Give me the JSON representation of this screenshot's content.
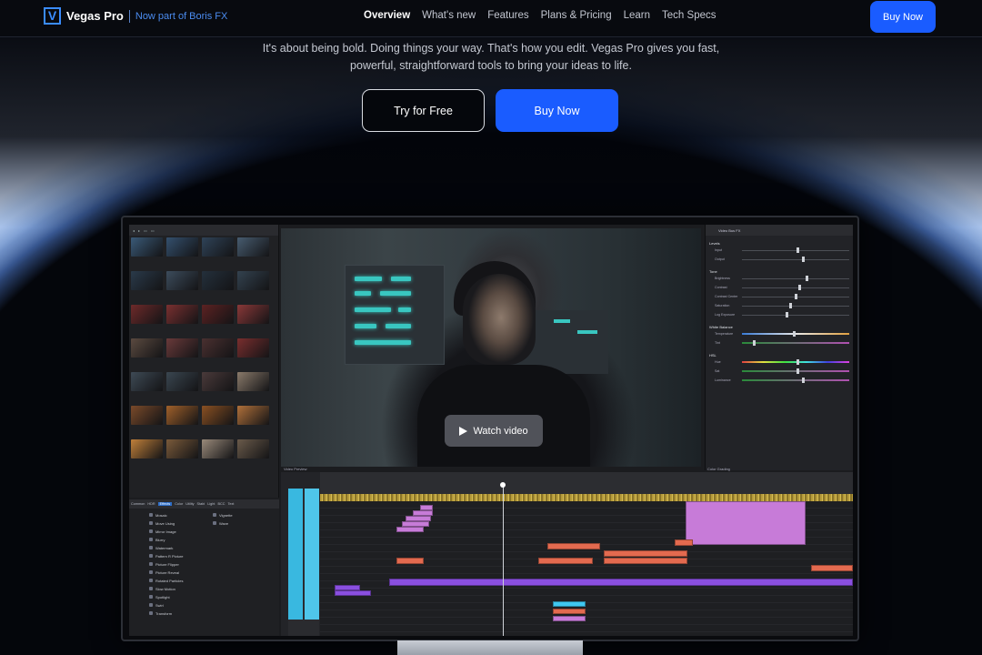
{
  "nav": {
    "logo_mark": "V",
    "logo_name": "Vegas Pro",
    "logo_tag": "Now part of Boris FX",
    "links": [
      "Overview",
      "What's new",
      "Features",
      "Plans & Pricing",
      "Learn",
      "Tech Specs"
    ],
    "active_link": "Overview",
    "buy_label": "Buy Now"
  },
  "hero": {
    "line1": "It's about being bold. Doing things your way. That's how you edit. Vegas Pro gives you fast,",
    "line2": "powerful, straightforward tools to bring your ideas to life.",
    "try_label": "Try for Free",
    "buy_label": "Buy Now"
  },
  "app": {
    "watch_label": "Watch video",
    "preview_label": "Video Preview",
    "grading_label": "Color Grading",
    "grading_title": "Video Bus FX",
    "grading_sections": [
      {
        "title": "Levels",
        "rows": [
          "Input",
          "Output"
        ]
      },
      {
        "title": "Tone",
        "rows": [
          "Brightness",
          "Contrast",
          "Contrast Center",
          "Saturation",
          "Log Exposure"
        ]
      },
      {
        "title": "White Balance",
        "rows": [
          "Temperature",
          "Tint"
        ]
      },
      {
        "title": "HSL",
        "rows": [
          "Hue",
          "Sat",
          "Luminance"
        ]
      }
    ],
    "fx_tabs": [
      "Common",
      "HDR",
      "Effects",
      "Color",
      "Utility",
      "Stabi",
      "Light",
      "BCC",
      "Text"
    ],
    "fx_active_tab": "Effects",
    "fx_items_col1": [
      "Mosaic",
      "Move Using",
      "Mirror Image",
      "Blurry",
      "Watermark",
      "Pattern R Picture",
      "Picture Flipper",
      "Picture Reveal",
      "Rotated Particles",
      "Slow Motion",
      "Spotlight",
      "Swirl",
      "Transform"
    ],
    "fx_items_col2": [
      "Vignette",
      "Wave"
    ]
  }
}
